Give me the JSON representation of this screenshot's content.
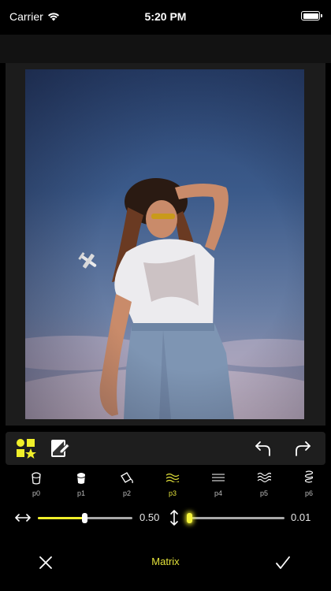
{
  "status_bar": {
    "carrier": "Carrier",
    "time": "5:20 PM"
  },
  "filters": [
    {
      "label": "p0",
      "icon": "paint-bucket-icon"
    },
    {
      "label": "p1",
      "icon": "paint-bucket-filled-icon"
    },
    {
      "label": "p2",
      "icon": "pour-bucket-icon"
    },
    {
      "label": "p3",
      "icon": "wave-lines-icon",
      "active": true
    },
    {
      "label": "p4",
      "icon": "straight-lines-icon"
    },
    {
      "label": "p5",
      "icon": "water-waves-icon"
    },
    {
      "label": "p6",
      "icon": "coil-icon"
    }
  ],
  "sliders": {
    "horizontal": {
      "value_label": "0.50",
      "value": 0.5
    },
    "vertical": {
      "value_label": "0.01",
      "value": 0.01
    }
  },
  "bottom_bar": {
    "title": "Matrix"
  },
  "colors": {
    "accent": "#e3e23a",
    "background": "#000000",
    "panel": "#1e1e1e"
  }
}
